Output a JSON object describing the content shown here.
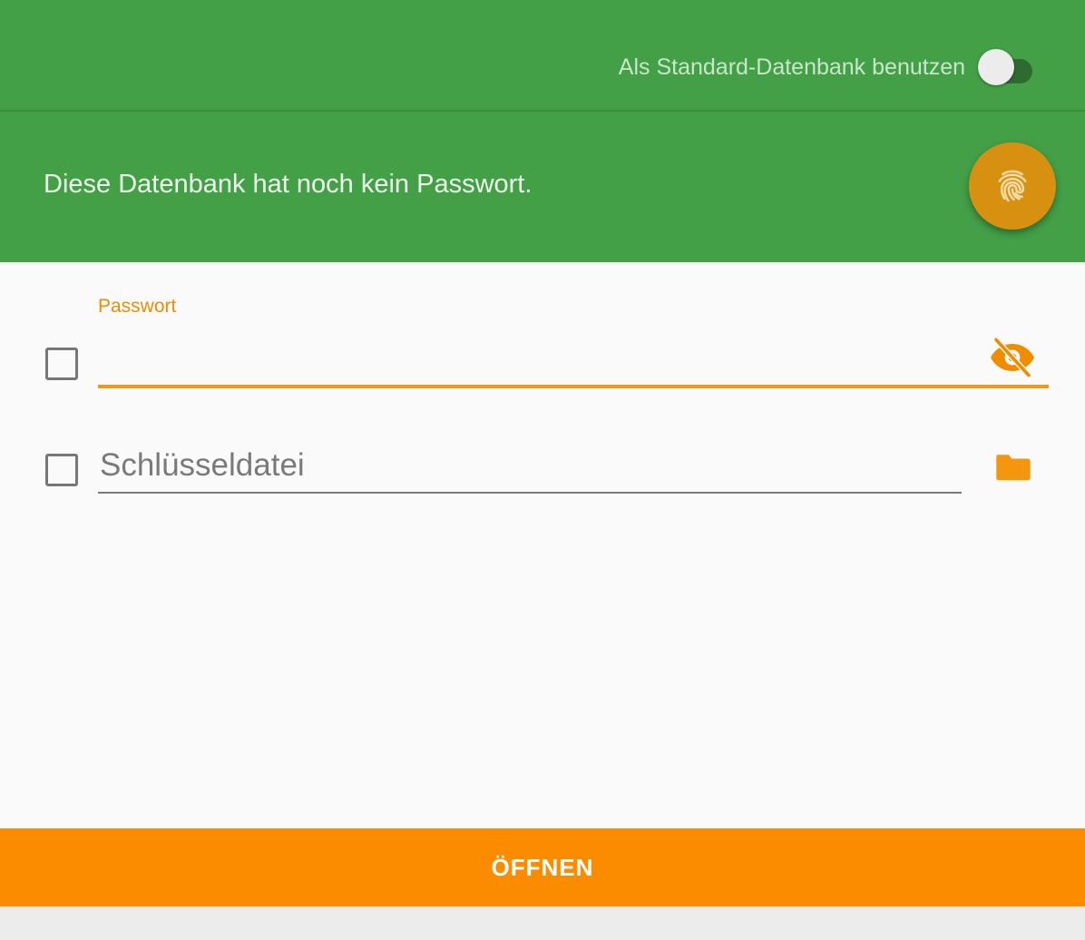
{
  "header": {
    "default_db_label": "Als Standard-Datenbank benutzen",
    "default_db_toggle_on": false
  },
  "banner": {
    "message": "Diese Datenbank hat noch kein Passwort.",
    "fab_icon": "fingerprint-icon"
  },
  "password": {
    "label": "Passwort",
    "value": "",
    "checked": false,
    "visibility_icon": "eye-off-icon"
  },
  "keyfile": {
    "placeholder": "Schlüsseldatei",
    "value": "",
    "checked": false,
    "browse_icon": "folder-icon"
  },
  "actions": {
    "open_label": "ÖFFNEN"
  },
  "colors": {
    "primary_green": "#43a047",
    "accent_orange": "#fb8c00",
    "fab_orange": "#d89011"
  }
}
